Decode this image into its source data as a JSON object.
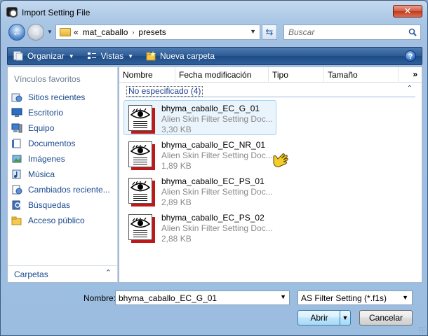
{
  "window": {
    "title": "Import Setting File",
    "close_glyph": "✕"
  },
  "address": {
    "prefix": "«",
    "segments": [
      "mat_caballo",
      "presets"
    ],
    "separator": "›",
    "search_placeholder": "Buscar"
  },
  "toolbar": {
    "organize": "Organizar",
    "views": "Vistas",
    "new_folder": "Nueva carpeta",
    "help": "?"
  },
  "sidebar": {
    "heading": "Vínculos favoritos",
    "items": [
      {
        "label": "Sitios recientes",
        "icon": "recent-places-icon"
      },
      {
        "label": "Escritorio",
        "icon": "desktop-icon"
      },
      {
        "label": "Equipo",
        "icon": "computer-icon"
      },
      {
        "label": "Documentos",
        "icon": "documents-icon"
      },
      {
        "label": "Imágenes",
        "icon": "pictures-icon"
      },
      {
        "label": "Música",
        "icon": "music-icon"
      },
      {
        "label": "Cambiados reciente...",
        "icon": "recently-changed-icon"
      },
      {
        "label": "Búsquedas",
        "icon": "searches-icon"
      },
      {
        "label": "Acceso público",
        "icon": "public-folder-icon"
      }
    ],
    "folders_label": "Carpetas"
  },
  "columns": [
    "Nombre",
    "Fecha modificación",
    "Tipo",
    "Tamaño"
  ],
  "group": {
    "label": "No especificado (4)"
  },
  "files": [
    {
      "name": "bhyma_caballo_EC_G_01",
      "type": "Alien Skin Filter Setting Doc...",
      "size": "3,30 KB",
      "selected": true
    },
    {
      "name": "bhyma_caballo_EC_NR_01",
      "type": "Alien Skin Filter Setting Doc...",
      "size": "1,89 KB",
      "selected": false
    },
    {
      "name": "bhyma_caballo_EC_PS_01",
      "type": "Alien Skin Filter Setting Doc...",
      "size": "2,89 KB",
      "selected": false
    },
    {
      "name": "bhyma_caballo_EC_PS_02",
      "type": "Alien Skin Filter Setting Doc...",
      "size": "2,88 KB",
      "selected": false
    }
  ],
  "footer": {
    "name_label": "Nombre:",
    "name_value": "bhyma_caballo_EC_G_01",
    "filter_value": "AS Filter Setting (*.f1s)",
    "open_label": "Abrir",
    "cancel_label": "Cancelar"
  },
  "colors": {
    "accent": "#1b4a8e",
    "toolbar": "#2c5a93",
    "selection": "#eaf4fc"
  }
}
